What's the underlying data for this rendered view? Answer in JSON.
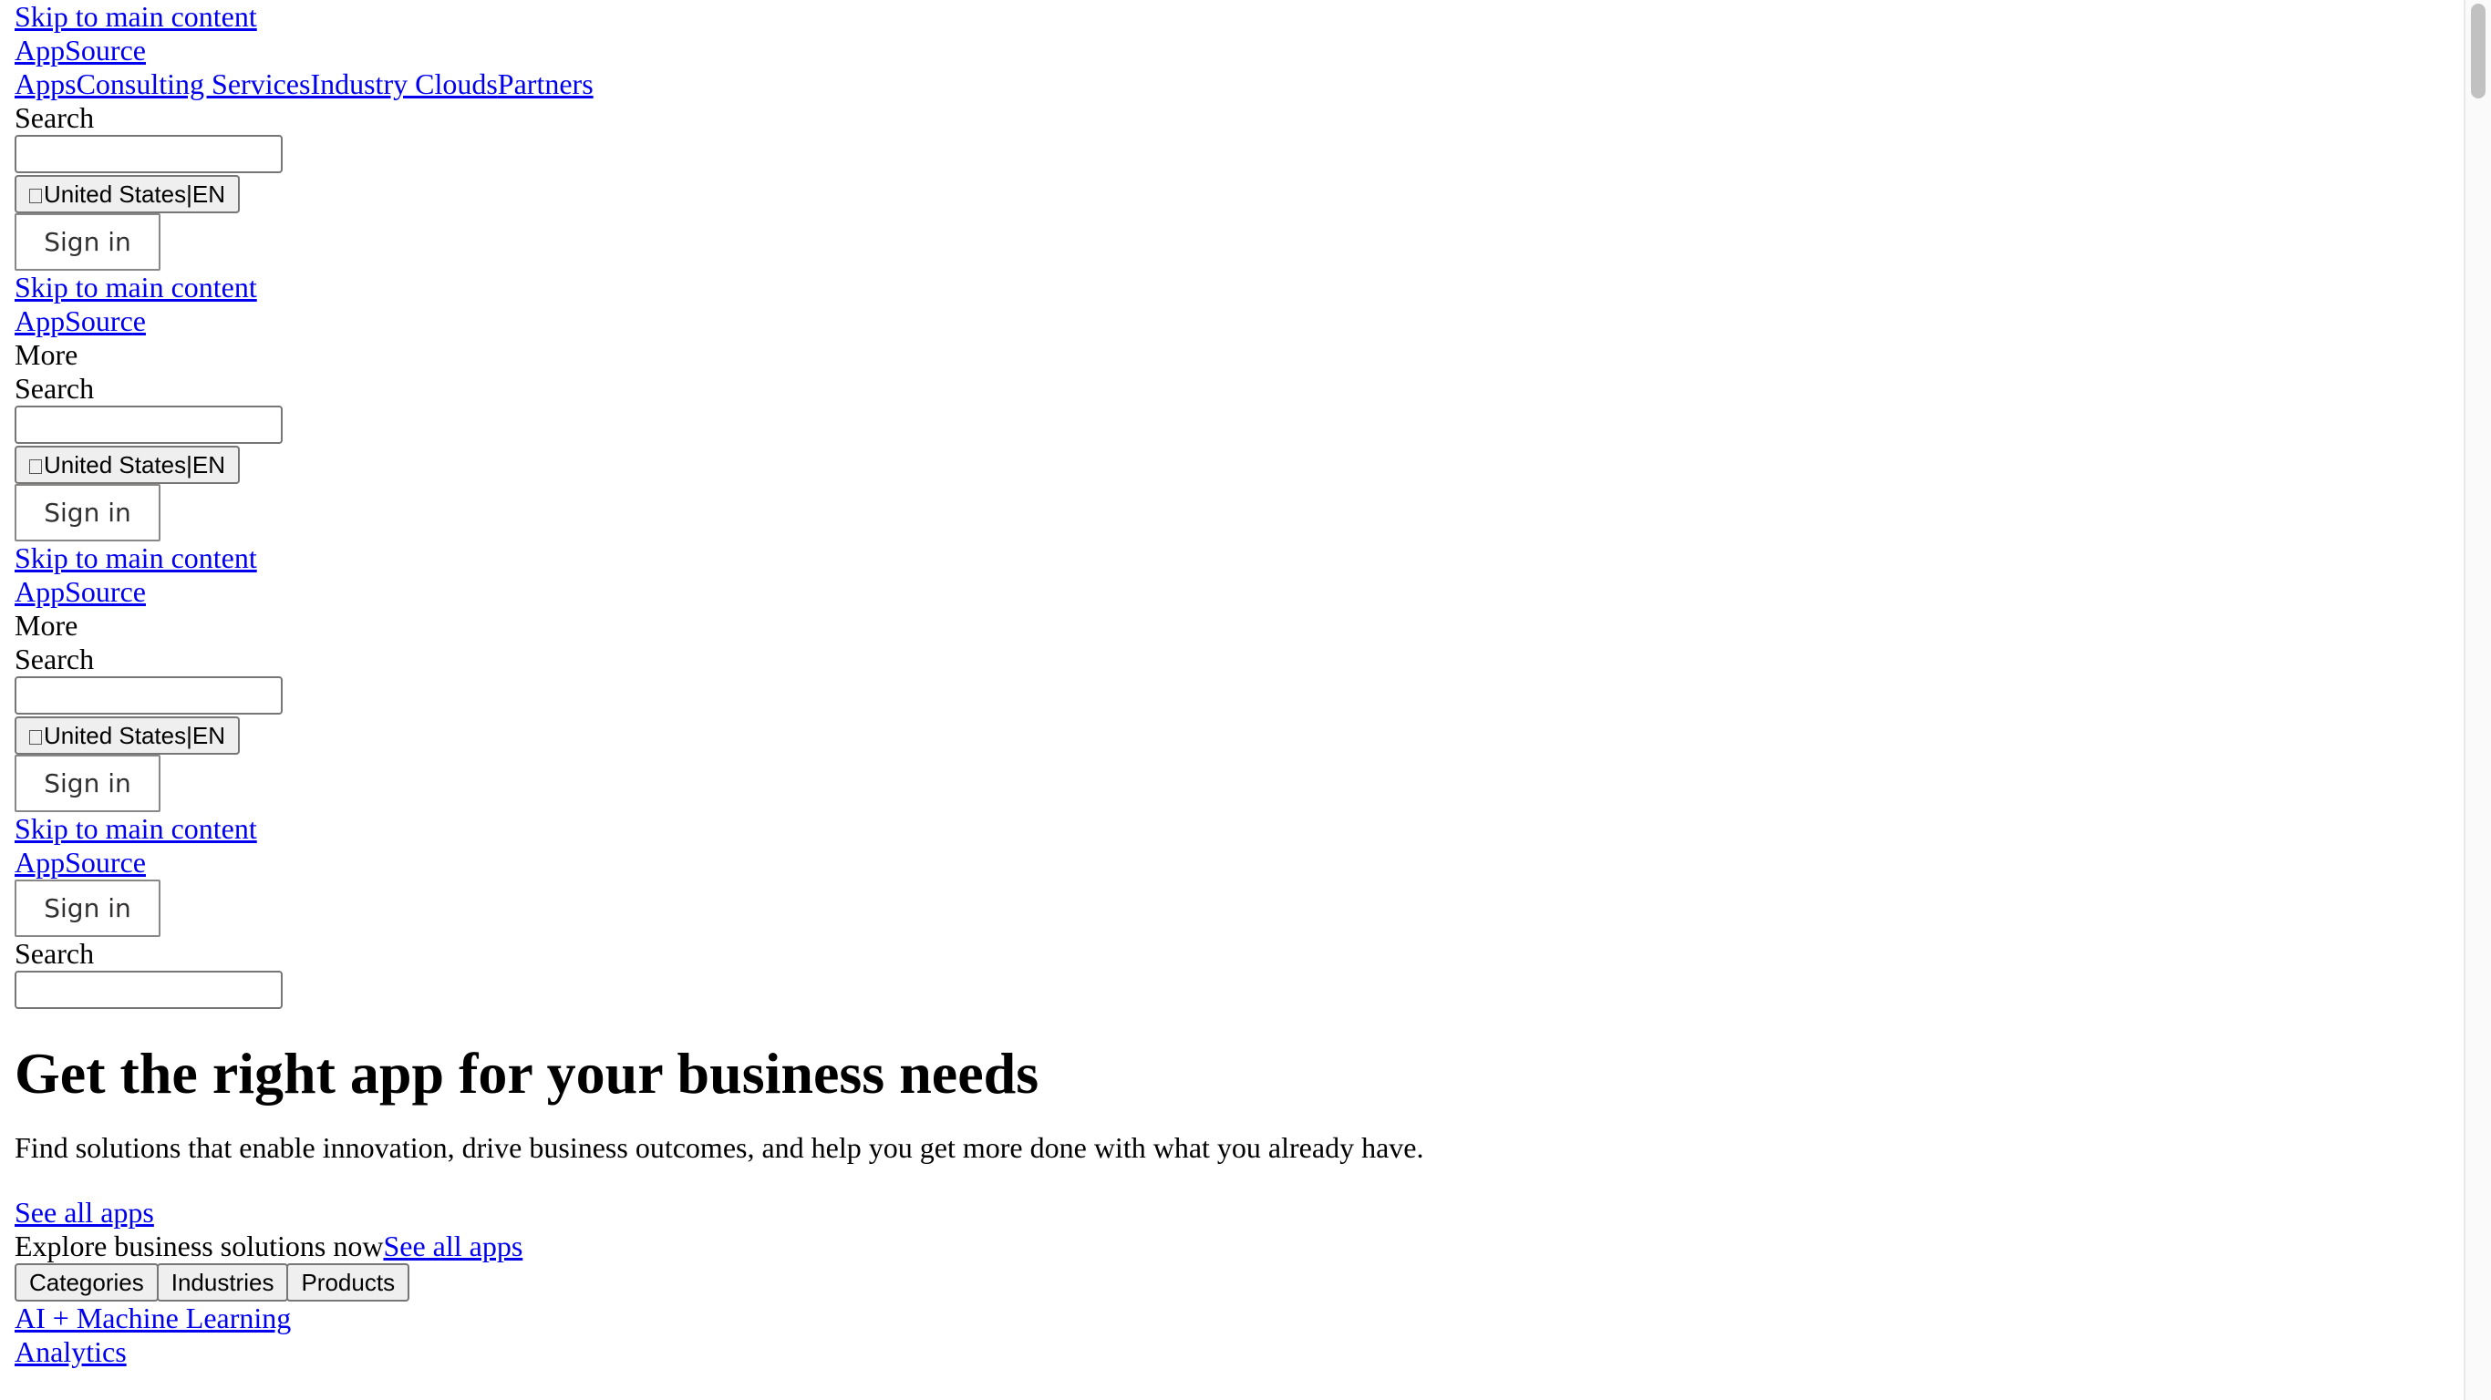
{
  "header1": {
    "skip": "Skip to main content",
    "logo": "AppSource",
    "nav": [
      "Apps",
      "Consulting Services",
      "Industry Clouds",
      "Partners"
    ],
    "search_label": "Search",
    "locale_country": "United States",
    "locale_sep": "|",
    "locale_lang": "EN",
    "signin": "Sign in"
  },
  "header2": {
    "skip": "Skip to main content",
    "logo": "AppSource",
    "more": "More",
    "search_label": "Search",
    "locale_country": "United States",
    "locale_sep": "|",
    "locale_lang": "EN",
    "signin": "Sign in"
  },
  "header3": {
    "skip": "Skip to main content",
    "logo": "AppSource",
    "more": "More",
    "search_label": "Search",
    "locale_country": "United States",
    "locale_sep": "|",
    "locale_lang": "EN",
    "signin": "Sign in"
  },
  "header4": {
    "skip": "Skip to main content",
    "logo": "AppSource",
    "signin": "Sign in",
    "search_label": "Search"
  },
  "hero": {
    "title": "Get the right app for your business needs",
    "subtitle": "Find solutions that enable innovation, drive business outcomes, and help you get more done with what you already have.",
    "cta": "See all apps"
  },
  "explore": {
    "text": "Explore business solutions now",
    "link": "See all apps",
    "tabs": [
      "Categories",
      "Industries",
      "Products"
    ],
    "items": [
      "AI + Machine Learning",
      "Analytics"
    ]
  }
}
